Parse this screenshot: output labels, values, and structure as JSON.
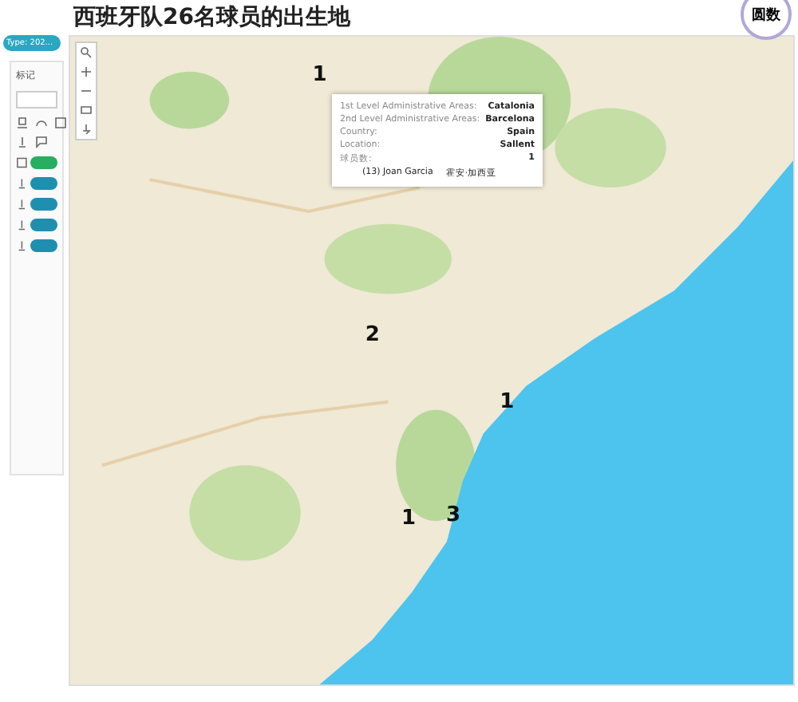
{
  "title": "西班牙队26名球员的出生地",
  "filter_chip": "Type: 202...",
  "marks_card": {
    "heading": "标记",
    "pills": [
      {
        "kind": "measure",
        "color": "#27ae60"
      },
      {
        "kind": "dimension",
        "color": "#1f8fb0"
      },
      {
        "kind": "dimension",
        "color": "#1f8fb0"
      },
      {
        "kind": "dimension",
        "color": "#1f8fb0"
      },
      {
        "kind": "dimension",
        "color": "#1f8fb0"
      }
    ]
  },
  "logo": "圆数",
  "map": {
    "markers": [
      {
        "label": "1"
      },
      {
        "label": "2"
      },
      {
        "label": "1"
      },
      {
        "label": "1"
      },
      {
        "label": "3"
      }
    ],
    "tooltip": {
      "rows": [
        {
          "label": "1st Level Administrative Areas:",
          "value": "Catalonia"
        },
        {
          "label": "2nd Level Administrative Areas:",
          "value": "Barcelona"
        },
        {
          "label": "Country:",
          "value": "Spain"
        },
        {
          "label": "Location:",
          "value": "Sallent"
        },
        {
          "label": "球员数:",
          "value": "1"
        }
      ],
      "player": "(13) Joan Garcia",
      "player_cn": "霍安·加西亚"
    }
  }
}
